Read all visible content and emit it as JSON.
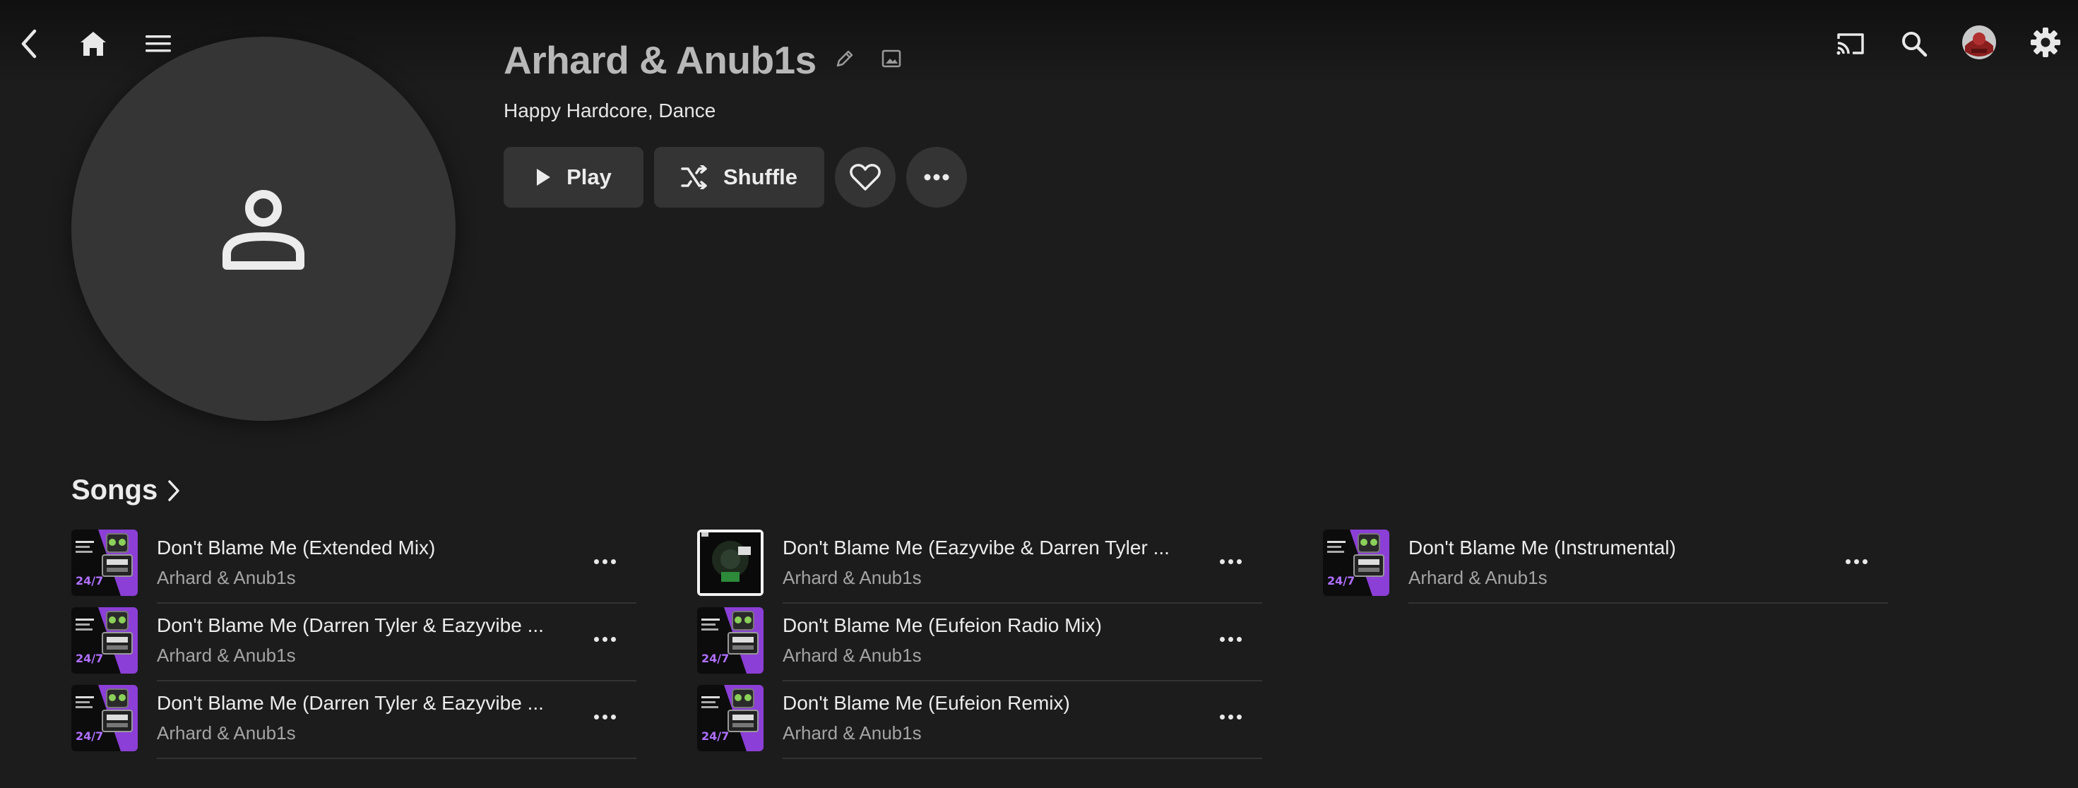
{
  "nav": {
    "back_icon": "chevron-left-icon",
    "home_icon": "home-icon",
    "menu_icon": "hamburger-menu-icon",
    "cast_icon": "cast-icon",
    "search_icon": "search-icon",
    "settings_icon": "gear-icon"
  },
  "artist": {
    "name": "Arhard & Anub1s",
    "genres": "Happy Hardcore, Dance",
    "placeholder_icon": "person-icon",
    "edit_icon": "pencil-icon",
    "image_icon": "image-icon"
  },
  "actions": {
    "play_label": "Play",
    "shuffle_label": "Shuffle",
    "favorite_icon": "heart-icon",
    "more_icon": "more-horizontal-icon"
  },
  "songs_section": {
    "title": "Songs",
    "chevron_icon": "chevron-right-icon",
    "columns": [
      [
        {
          "title": "Don't Blame Me (Extended Mix)",
          "artist": "Arhard & Anub1s",
          "art": "purple"
        },
        {
          "title": "Don't Blame Me (Darren Tyler & Eazyvibe ...",
          "artist": "Arhard & Anub1s",
          "art": "purple"
        },
        {
          "title": "Don't Blame Me (Darren Tyler & Eazyvibe ...",
          "artist": "Arhard & Anub1s",
          "art": "purple"
        }
      ],
      [
        {
          "title": "Don't Blame Me (Eazyvibe & Darren Tyler ...",
          "artist": "Arhard & Anub1s",
          "art": "dark"
        },
        {
          "title": "Don't Blame Me (Eufeion Radio Mix)",
          "artist": "Arhard & Anub1s",
          "art": "purple"
        },
        {
          "title": "Don't Blame Me (Eufeion Remix)",
          "artist": "Arhard & Anub1s",
          "art": "purple"
        }
      ],
      [
        {
          "title": "Don't Blame Me (Instrumental)",
          "artist": "Arhard & Anub1s",
          "art": "purple"
        }
      ]
    ]
  },
  "colors": {
    "background": "#1c1c1c",
    "button_bg": "#343434",
    "avatar_bg": "#353535",
    "art_purple": "#8b3fd6",
    "art_black": "#0c0c0c"
  }
}
